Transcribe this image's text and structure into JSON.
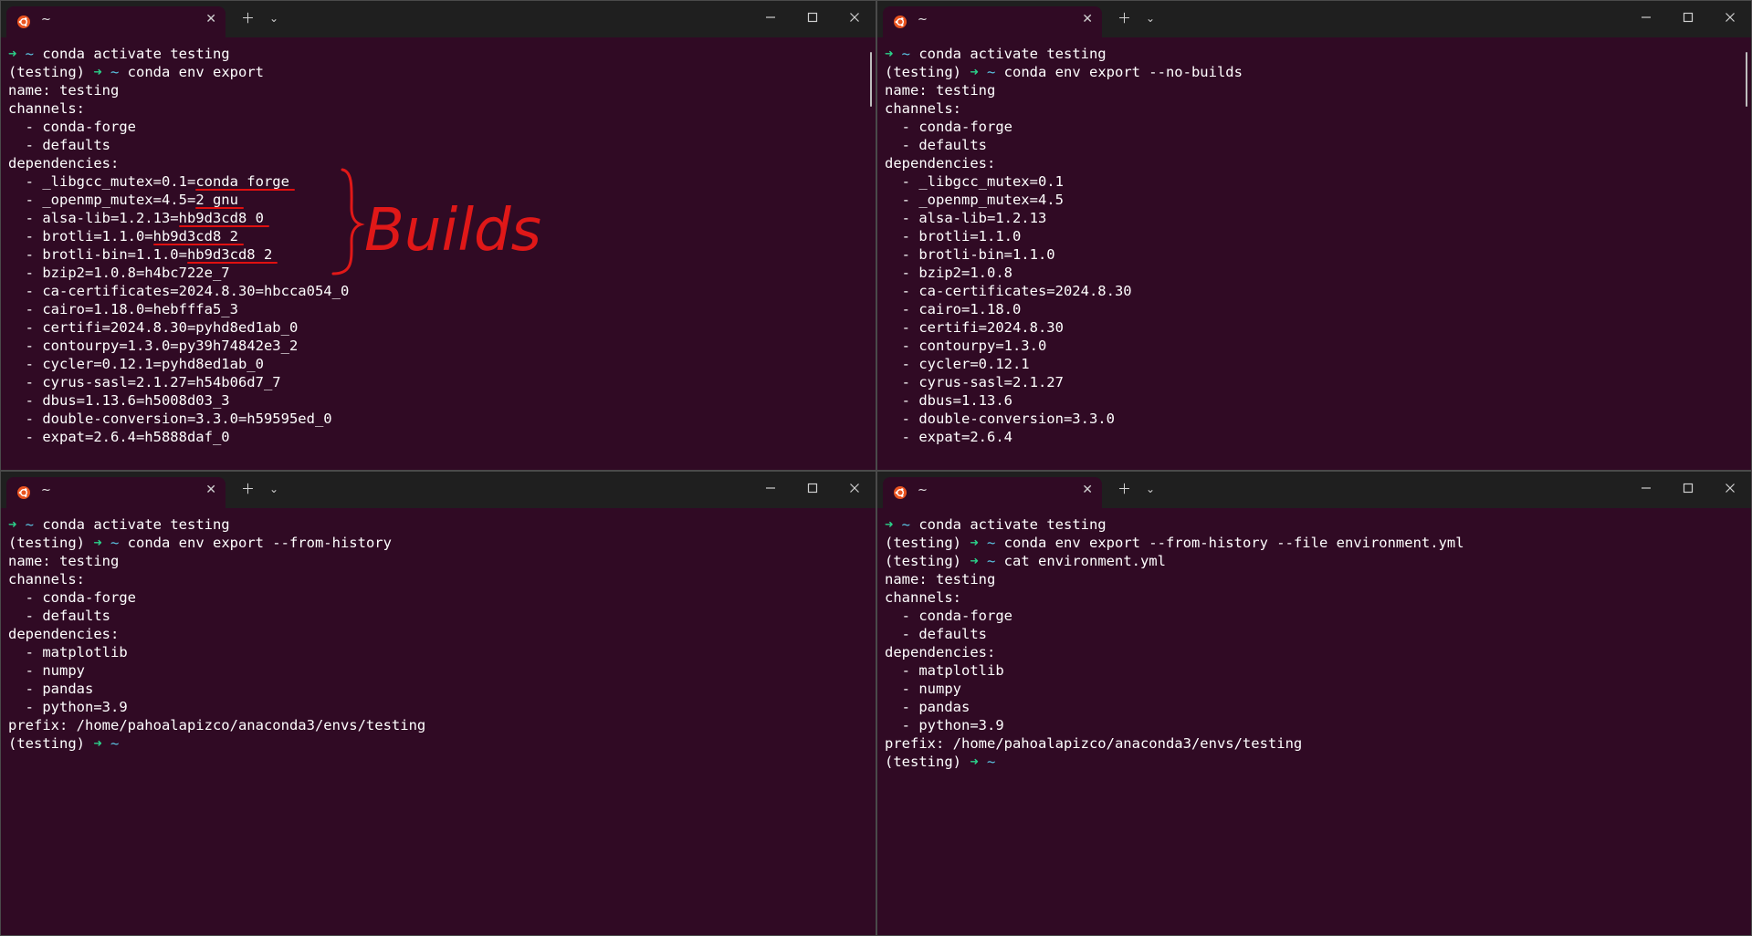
{
  "colors": {
    "terminal_bg": "#300a24",
    "titlebar_bg": "#1f1f1f",
    "prompt_arrow": "#2bd18a",
    "prompt_tilde": "#5bc8e6",
    "annotation": "#e01818"
  },
  "icons": {
    "tab_icon": "ubuntu-icon",
    "new_tab": "plus-icon",
    "dropdown": "chevron-down-icon",
    "minimize": "minimize-icon",
    "maximize": "maximize-icon",
    "close": "close-icon"
  },
  "windows": [
    {
      "tab_title": "~",
      "lines": [
        {
          "segments": [
            {
              "t": "➜ ",
              "c": "arrow"
            },
            {
              "t": "~ ",
              "c": "tilde"
            },
            {
              "t": "conda activate testing"
            }
          ]
        },
        {
          "segments": [
            {
              "t": "(testing) "
            },
            {
              "t": "➜ ",
              "c": "arrow"
            },
            {
              "t": "~ ",
              "c": "tilde"
            },
            {
              "t": "conda env export"
            }
          ]
        },
        {
          "segments": [
            {
              "t": "name: testing"
            }
          ]
        },
        {
          "segments": [
            {
              "t": "channels:"
            }
          ]
        },
        {
          "segments": [
            {
              "t": "  - conda-forge"
            }
          ]
        },
        {
          "segments": [
            {
              "t": "  - defaults"
            }
          ]
        },
        {
          "segments": [
            {
              "t": "dependencies:"
            }
          ]
        },
        {
          "segments": [
            {
              "t": "  - _libgcc_mutex=0.1="
            },
            {
              "t": "conda_forge",
              "c": "ul"
            }
          ]
        },
        {
          "segments": [
            {
              "t": "  - _openmp_mutex=4.5="
            },
            {
              "t": "2_gnu",
              "c": "ul"
            }
          ]
        },
        {
          "segments": [
            {
              "t": "  - alsa-lib=1.2.13="
            },
            {
              "t": "hb9d3cd8_0",
              "c": "ul"
            }
          ]
        },
        {
          "segments": [
            {
              "t": "  - brotli=1.1.0="
            },
            {
              "t": "hb9d3cd8_2",
              "c": "ul"
            }
          ]
        },
        {
          "segments": [
            {
              "t": "  - brotli-bin=1.1.0="
            },
            {
              "t": "hb9d3cd8_2",
              "c": "ul"
            }
          ]
        },
        {
          "segments": [
            {
              "t": "  - bzip2=1.0.8=h4bc722e_7"
            }
          ]
        },
        {
          "segments": [
            {
              "t": "  - ca-certificates=2024.8.30=hbcca054_0"
            }
          ]
        },
        {
          "segments": [
            {
              "t": "  - cairo=1.18.0=hebfffa5_3"
            }
          ]
        },
        {
          "segments": [
            {
              "t": "  - certifi=2024.8.30=pyhd8ed1ab_0"
            }
          ]
        },
        {
          "segments": [
            {
              "t": "  - contourpy=1.3.0=py39h74842e3_2"
            }
          ]
        },
        {
          "segments": [
            {
              "t": "  - cycler=0.12.1=pyhd8ed1ab_0"
            }
          ]
        },
        {
          "segments": [
            {
              "t": "  - cyrus-sasl=2.1.27=h54b06d7_7"
            }
          ]
        },
        {
          "segments": [
            {
              "t": "  - dbus=1.13.6=h5008d03_3"
            }
          ]
        },
        {
          "segments": [
            {
              "t": "  - double-conversion=3.3.0=h59595ed_0"
            }
          ]
        },
        {
          "segments": [
            {
              "t": "  - expat=2.6.4=h5888daf_0"
            }
          ]
        }
      ]
    },
    {
      "tab_title": "~",
      "lines": [
        {
          "segments": [
            {
              "t": "➜ ",
              "c": "arrow"
            },
            {
              "t": "~ ",
              "c": "tilde"
            },
            {
              "t": "conda activate testing"
            }
          ]
        },
        {
          "segments": [
            {
              "t": "(testing) "
            },
            {
              "t": "➜ ",
              "c": "arrow"
            },
            {
              "t": "~ ",
              "c": "tilde"
            },
            {
              "t": "conda env export --no-builds"
            }
          ]
        },
        {
          "segments": [
            {
              "t": "name: testing"
            }
          ]
        },
        {
          "segments": [
            {
              "t": "channels:"
            }
          ]
        },
        {
          "segments": [
            {
              "t": "  - conda-forge"
            }
          ]
        },
        {
          "segments": [
            {
              "t": "  - defaults"
            }
          ]
        },
        {
          "segments": [
            {
              "t": "dependencies:"
            }
          ]
        },
        {
          "segments": [
            {
              "t": "  - _libgcc_mutex=0.1"
            }
          ]
        },
        {
          "segments": [
            {
              "t": "  - _openmp_mutex=4.5"
            }
          ]
        },
        {
          "segments": [
            {
              "t": "  - alsa-lib=1.2.13"
            }
          ]
        },
        {
          "segments": [
            {
              "t": "  - brotli=1.1.0"
            }
          ]
        },
        {
          "segments": [
            {
              "t": "  - brotli-bin=1.1.0"
            }
          ]
        },
        {
          "segments": [
            {
              "t": "  - bzip2=1.0.8"
            }
          ]
        },
        {
          "segments": [
            {
              "t": "  - ca-certificates=2024.8.30"
            }
          ]
        },
        {
          "segments": [
            {
              "t": "  - cairo=1.18.0"
            }
          ]
        },
        {
          "segments": [
            {
              "t": "  - certifi=2024.8.30"
            }
          ]
        },
        {
          "segments": [
            {
              "t": "  - contourpy=1.3.0"
            }
          ]
        },
        {
          "segments": [
            {
              "t": "  - cycler=0.12.1"
            }
          ]
        },
        {
          "segments": [
            {
              "t": "  - cyrus-sasl=2.1.27"
            }
          ]
        },
        {
          "segments": [
            {
              "t": "  - dbus=1.13.6"
            }
          ]
        },
        {
          "segments": [
            {
              "t": "  - double-conversion=3.3.0"
            }
          ]
        },
        {
          "segments": [
            {
              "t": "  - expat=2.6.4"
            }
          ]
        }
      ]
    },
    {
      "tab_title": "~",
      "lines": [
        {
          "segments": [
            {
              "t": "➜ ",
              "c": "arrow"
            },
            {
              "t": "~ ",
              "c": "tilde"
            },
            {
              "t": "conda activate testing"
            }
          ]
        },
        {
          "segments": [
            {
              "t": "(testing) "
            },
            {
              "t": "➜ ",
              "c": "arrow"
            },
            {
              "t": "~ ",
              "c": "tilde"
            },
            {
              "t": "conda env export --from-history"
            }
          ]
        },
        {
          "segments": [
            {
              "t": "name: testing"
            }
          ]
        },
        {
          "segments": [
            {
              "t": "channels:"
            }
          ]
        },
        {
          "segments": [
            {
              "t": "  - conda-forge"
            }
          ]
        },
        {
          "segments": [
            {
              "t": "  - defaults"
            }
          ]
        },
        {
          "segments": [
            {
              "t": "dependencies:"
            }
          ]
        },
        {
          "segments": [
            {
              "t": "  - matplotlib"
            }
          ]
        },
        {
          "segments": [
            {
              "t": "  - numpy"
            }
          ]
        },
        {
          "segments": [
            {
              "t": "  - pandas"
            }
          ]
        },
        {
          "segments": [
            {
              "t": "  - python=3.9"
            }
          ]
        },
        {
          "segments": [
            {
              "t": "prefix: /home/pahoalapizco/anaconda3/envs/testing"
            }
          ]
        },
        {
          "segments": [
            {
              "t": "(testing) "
            },
            {
              "t": "➜ ",
              "c": "arrow"
            },
            {
              "t": "~",
              "c": "tilde"
            }
          ]
        }
      ]
    },
    {
      "tab_title": "~",
      "lines": [
        {
          "segments": [
            {
              "t": "➜ ",
              "c": "arrow"
            },
            {
              "t": "~ ",
              "c": "tilde"
            },
            {
              "t": "conda activate testing"
            }
          ]
        },
        {
          "segments": [
            {
              "t": "(testing) "
            },
            {
              "t": "➜ ",
              "c": "arrow"
            },
            {
              "t": "~ ",
              "c": "tilde"
            },
            {
              "t": "conda env export --from-history --file environment.yml"
            }
          ]
        },
        {
          "segments": [
            {
              "t": "(testing) "
            },
            {
              "t": "➜ ",
              "c": "arrow"
            },
            {
              "t": "~ ",
              "c": "tilde"
            },
            {
              "t": "cat environment.yml"
            }
          ]
        },
        {
          "segments": [
            {
              "t": "name: testing"
            }
          ]
        },
        {
          "segments": [
            {
              "t": "channels:"
            }
          ]
        },
        {
          "segments": [
            {
              "t": "  - conda-forge"
            }
          ]
        },
        {
          "segments": [
            {
              "t": "  - defaults"
            }
          ]
        },
        {
          "segments": [
            {
              "t": "dependencies:"
            }
          ]
        },
        {
          "segments": [
            {
              "t": "  - matplotlib"
            }
          ]
        },
        {
          "segments": [
            {
              "t": "  - numpy"
            }
          ]
        },
        {
          "segments": [
            {
              "t": "  - pandas"
            }
          ]
        },
        {
          "segments": [
            {
              "t": "  - python=3.9"
            }
          ]
        },
        {
          "segments": [
            {
              "t": "prefix: /home/pahoalapizco/anaconda3/envs/testing"
            }
          ]
        },
        {
          "segments": [
            {
              "t": "(testing) "
            },
            {
              "t": "➜ ",
              "c": "arrow"
            },
            {
              "t": "~",
              "c": "tilde"
            }
          ]
        }
      ]
    }
  ],
  "annotation": {
    "text": "Builds"
  }
}
